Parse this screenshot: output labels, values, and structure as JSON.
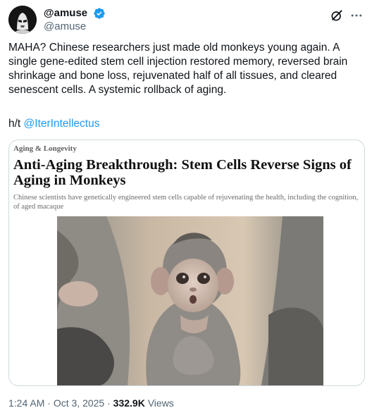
{
  "author": {
    "display_name": "@amuse",
    "handle": "@amuse",
    "verified": true,
    "avatar_icon": "storm-trooper-avatar"
  },
  "actions": {
    "grok_icon": "grok-icon",
    "more_icon": "more-icon"
  },
  "tweet": {
    "text": "MAHA? Chinese researchers just made old monkeys young again. A single gene-edited stem cell injection restored memory, reversed brain shrinkage and bone loss, rejuvenated half of all tissues, and cleared senescent cells. A systemic rollback of aging.",
    "hat_tip_prefix": "h/t ",
    "hat_tip_mention": "@IterIntellectus"
  },
  "card": {
    "category": "Aging & Longevity",
    "headline": "Anti-Aging Breakthrough: Stem Cells Reverse Signs of Aging in Monkeys",
    "summary": "Chinese scientists have genetically engineered stem cells capable of rejuvenating the health, including the cognition, of aged macaque",
    "image": "baby-macaque-photo"
  },
  "meta": {
    "time": "1:24 AM",
    "separator": " · ",
    "date": "Oct 3, 2025",
    "views_count": "332.9K",
    "views_label": " Views"
  },
  "colors": {
    "accent": "#1d9bf0",
    "text": "#0f1419",
    "secondary": "#536471",
    "border": "#cfd9de"
  }
}
